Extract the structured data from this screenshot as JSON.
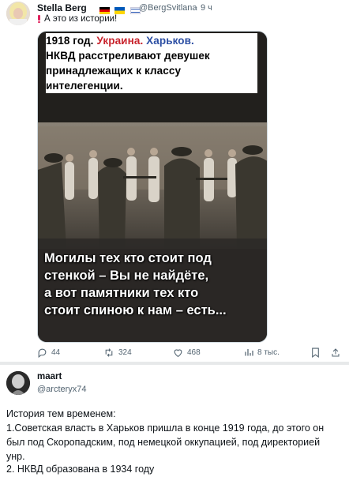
{
  "tweet": {
    "author_name": "Stella Berg",
    "author_handle": "@BergSvitlana",
    "time": "9 ч",
    "text_icon": "exclamation-icon",
    "text": "А это из истории!",
    "image": {
      "caption_top_1_a": "1918 год.",
      "caption_top_1_b": "Украина.",
      "caption_top_1_c": "Харьков.",
      "caption_top_2": "НКВД  расстреливают  девушек",
      "caption_top_3": "принадлежащих  к классу",
      "caption_top_4": "интелегенции.",
      "caption_bottom_1": "Могилы тех кто стоит под",
      "caption_bottom_2": "стенкой – Вы не найдёте,",
      "caption_bottom_3": "а вот памятники тех кто",
      "caption_bottom_4": "стоит спиною к нам – есть..."
    },
    "actions": {
      "replies": "44",
      "retweets": "324",
      "likes": "468",
      "views": "8 тыс."
    }
  },
  "reply": {
    "author_name": "maart",
    "author_handle": "@arcteryx74",
    "line1": "История тем временем:",
    "line2": "1.Советская власть в Харьков пришла в конце 1919 года, до этого он",
    "line3": "был под Скоропадским, под  немецкой оккупацией, под директорией",
    "line4": "унр.",
    "line5": "2. НКВД образована в 1934 году"
  }
}
